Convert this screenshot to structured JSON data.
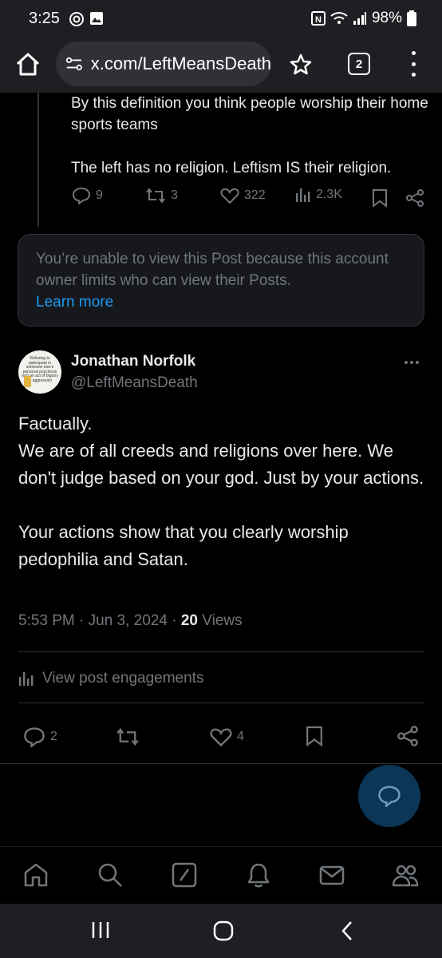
{
  "status_bar": {
    "time": "3:25",
    "battery": "98%"
  },
  "browser": {
    "url": "x.com/LeftMeansDeath",
    "tab_count": "2"
  },
  "previous_post": {
    "text_line1": "By this definition you think people worship their home sports teams",
    "text_line2": "The left has no religion. Leftism IS their religion.",
    "replies": "9",
    "reposts": "3",
    "likes": "322",
    "views": "2.3K"
  },
  "restricted_notice": {
    "message": "You’re unable to view this Post because this account owner limits who can view their Posts.",
    "link": "Learn more"
  },
  "post": {
    "author_name": "Jonathan Norfolk",
    "author_handle": "@LeftMeansDeath",
    "avatar_text": "Refusing to participate in someone else's personal psychosis isn't an act of bigotry or aggression",
    "paragraph1_lines": [
      "Factually.",
      "We are of all creeds and religions over here. We don't judge based on your god. Just by your actions."
    ],
    "line1": "Factually.",
    "line2": "We are of all creeds and religions over here. We don't judge based on your god. Just by your actions.",
    "line3": "Your actions show that you clearly worship pedophilia and Satan.",
    "timestamp": "5:53 PM · Jun 3, 2024 · ",
    "views_count": "20",
    "views_label": " Views",
    "engagements_label": "View post engagements",
    "replies": "2",
    "likes": "4"
  },
  "colors": {
    "background": "#000000",
    "text_primary": "#e7e9ea",
    "text_secondary": "#71767b",
    "accent": "#1d9bf0",
    "divider": "#2f3336"
  },
  "icons": {
    "tabbar": [
      "home-icon",
      "search-icon",
      "grok-icon",
      "bell-icon",
      "mail-icon",
      "communities-icon"
    ],
    "fab": "chat-bubble-icon"
  }
}
